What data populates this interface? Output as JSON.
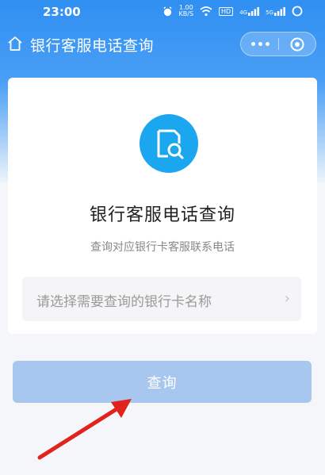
{
  "status_bar": {
    "time": "23:00",
    "speed_value": "1.00",
    "speed_unit": "KB/S",
    "hd": "HD",
    "network1": "4G",
    "network2": "5G"
  },
  "nav": {
    "title": "银行客服电话查询"
  },
  "card": {
    "title": "银行客服电话查询",
    "subtitle": "查询对应银行卡客服联系电话",
    "select_placeholder": "请选择需要查询的银行卡名称"
  },
  "button": {
    "label": "查询"
  },
  "icons": {
    "home": "home-icon",
    "more": "more-icon",
    "close": "close-circle-icon",
    "search_doc": "document-search-icon",
    "chevron": "chevron-right-icon",
    "annotation_arrow": "arrow-icon"
  },
  "colors": {
    "header_blue": "#2f8ff2",
    "icon_circle": "#1aa7ef",
    "button_disabled": "#a8c7ef",
    "arrow_red": "#e0231c"
  }
}
